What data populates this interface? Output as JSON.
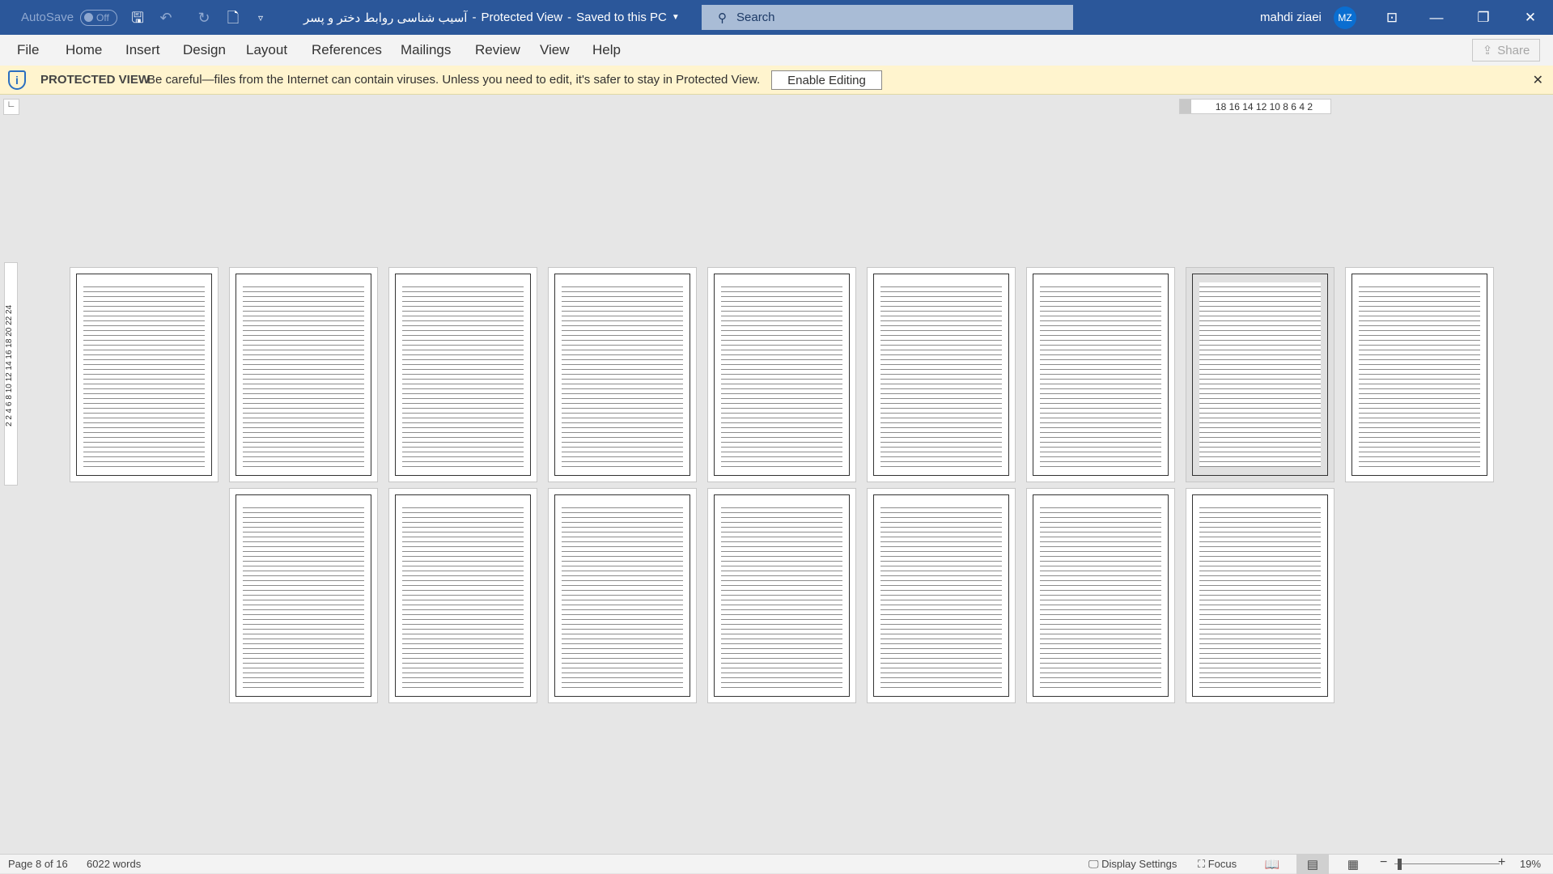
{
  "titlebar": {
    "autosave_label": "AutoSave",
    "autosave_state": "Off",
    "document_title": "آسیب شناسی روابط دختر و پسر",
    "separator": "-",
    "mode": "Protected View",
    "save_status": "Saved to this PC",
    "search_placeholder": "Search",
    "user_name": "mahdi ziaei",
    "user_initials": "MZ"
  },
  "menu": [
    "File",
    "Home",
    "Insert",
    "Design",
    "Layout",
    "References",
    "Mailings",
    "Review",
    "View",
    "Help"
  ],
  "share_label": "Share",
  "protected_view": {
    "title": "PROTECTED VIEW",
    "message": "Be careful—files from the Internet can contain viruses. Unless you need to edit, it's safer to stay in Protected View.",
    "button": "Enable Editing"
  },
  "ruler": {
    "horizontal": "18 16 14 12 10 8 6 4 2",
    "vertical": "2 2 4 6 8 10 12 14 16 18 20 22 24"
  },
  "document": {
    "page_count": 16,
    "current_page": 8
  },
  "status": {
    "page": "Page 8 of 16",
    "words": "6022 words",
    "display_settings": "Display Settings",
    "focus": "Focus",
    "zoom": "19%"
  },
  "colors": {
    "title_bar": "#2b579a",
    "protected_bar": "#fff4ce"
  }
}
